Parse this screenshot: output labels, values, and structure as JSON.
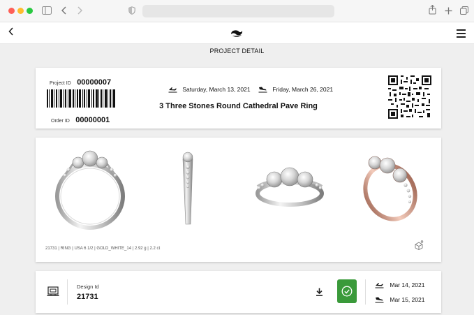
{
  "browser": {
    "icons": [
      "close-dot",
      "minimize-dot",
      "zoom-dot",
      "sidebar-icon",
      "back-arrow-icon",
      "forward-arrow-icon",
      "shield-icon",
      "share-icon",
      "new-tab-icon",
      "tabs-icon"
    ]
  },
  "header": {
    "logo": "brand-logo",
    "subtitle": "PROJECT DETAIL"
  },
  "project": {
    "project_id_label": "Project ID",
    "project_id": "00000007",
    "order_id_label": "Order ID",
    "order_id": "00000001",
    "start_date": "Saturday, March 13, 2021",
    "end_date": "Friday, March 26, 2021",
    "title": "3 Three Stones Round Cathedral Pave Ring"
  },
  "product": {
    "spec": "21731 | RING | USA 6 1/2 | GOLD_WHITE_14 | 2.92 g | 2.2 ct",
    "views": [
      "front-view",
      "side-view",
      "top-view",
      "rose-gold-perspective-view"
    ]
  },
  "design": {
    "label": "Design Id",
    "id": "21731",
    "departure_date": "Mar 14, 2021",
    "arrival_date": "Mar 15, 2021"
  },
  "colors": {
    "approve_green": "#3a9a3a",
    "background": "#efefef"
  }
}
